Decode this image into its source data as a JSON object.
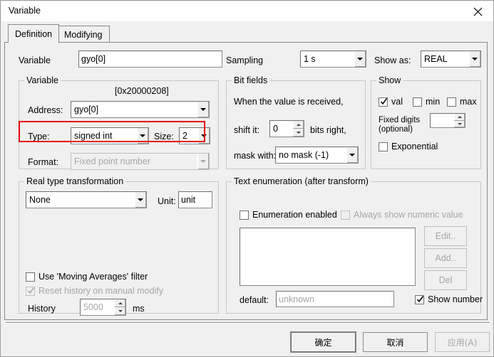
{
  "window": {
    "title": "Variable",
    "close_icon": "close-icon"
  },
  "tabs": [
    {
      "label": "Definition",
      "selected": true
    },
    {
      "label": "Modifying",
      "selected": false
    }
  ],
  "top_row": {
    "variable_label": "Variable",
    "variable_value": "gyo[0]",
    "sampling_label": "Sampling",
    "sampling_value": "1 s",
    "show_as_label": "Show as:",
    "show_as_value": "REAL"
  },
  "variable_group": {
    "title": "Variable",
    "address_hex": "[0x20000208]",
    "address_label": "Address:",
    "address_value": "gyo[0]",
    "type_label": "Type:",
    "type_value": "signed int",
    "size_label": "Size:",
    "size_value": "2",
    "format_label": "Format:",
    "format_value": "Fixed point number"
  },
  "bit_fields_group": {
    "title": "Bit fields",
    "intro_text": "When the value is received,",
    "shift_label": "shift it:",
    "shift_value": "0",
    "bits_right_label": "bits right,",
    "mask_label": "mask with:",
    "mask_value": "no mask (-1)"
  },
  "show_group": {
    "title": "Show",
    "val_label": "val",
    "val_checked": true,
    "min_label": "min",
    "min_checked": false,
    "max_label": "max",
    "max_checked": false,
    "fixed_digits_label_1": "Fixed digits",
    "fixed_digits_label_2": "(optional)",
    "fixed_digits_value": "",
    "exponential_label": "Exponential",
    "exponential_checked": false
  },
  "real_type_group": {
    "title": "Real type transformation",
    "transform_value": "None",
    "unit_label": "Unit:",
    "unit_value": "unit",
    "moving_avg_label": "Use 'Moving Averages' filter",
    "moving_avg_checked": false,
    "reset_history_label": "Reset history on manual modify",
    "reset_history_checked": true,
    "history_label": "History",
    "history_value": "5000",
    "history_units": "ms"
  },
  "text_enum_group": {
    "title": "Text enumeration (after transform)",
    "enum_enabled_label": "Enumeration enabled",
    "enum_enabled_checked": false,
    "always_show_label": "Always show numeric value",
    "always_show_checked": false,
    "list_items": [],
    "edit_button": "Edit..",
    "add_button": "Add..",
    "del_button": "Del",
    "default_label": "default:",
    "default_value": "unknown",
    "show_number_label": "Show number",
    "show_number_checked": true
  },
  "footer": {
    "ok_button": "确定",
    "cancel_button": "取消",
    "apply_button": "应用(A)"
  },
  "colors": {
    "highlight": "#e8000b",
    "dialog_bg": "#f0f0f0",
    "field_bg": "#ffffff",
    "disabled_text": "#a6a6a6"
  }
}
